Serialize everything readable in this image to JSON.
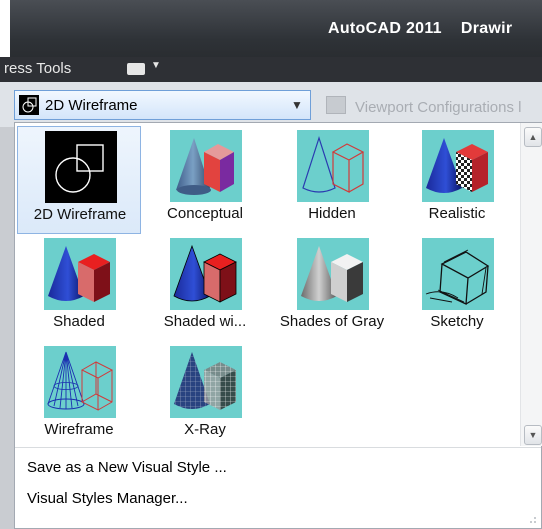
{
  "titlebar": {
    "title": "AutoCAD 2011",
    "doc": "Drawir"
  },
  "menubar": {
    "express_tools": "ress Tools"
  },
  "ribbon": {
    "visual_style_combo": {
      "value": "2D Wireframe"
    },
    "viewport_configurations": "Viewport Configurations l"
  },
  "gallery": {
    "items": [
      {
        "label": "2D Wireframe",
        "selected": true
      },
      {
        "label": "Conceptual"
      },
      {
        "label": "Hidden"
      },
      {
        "label": "Realistic"
      },
      {
        "label": "Shaded"
      },
      {
        "label": "Shaded wi..."
      },
      {
        "label": "Shades of Gray"
      },
      {
        "label": "Sketchy"
      },
      {
        "label": "Wireframe"
      },
      {
        "label": "X-Ray"
      }
    ]
  },
  "menu": {
    "save_as": "Save as a New Visual Style ...",
    "manager": "Visual Styles Manager..."
  },
  "colors": {
    "thumb_bg": "#6ccfcc",
    "selection": "#dbe9f9",
    "titlebar": "#3a3e43"
  }
}
